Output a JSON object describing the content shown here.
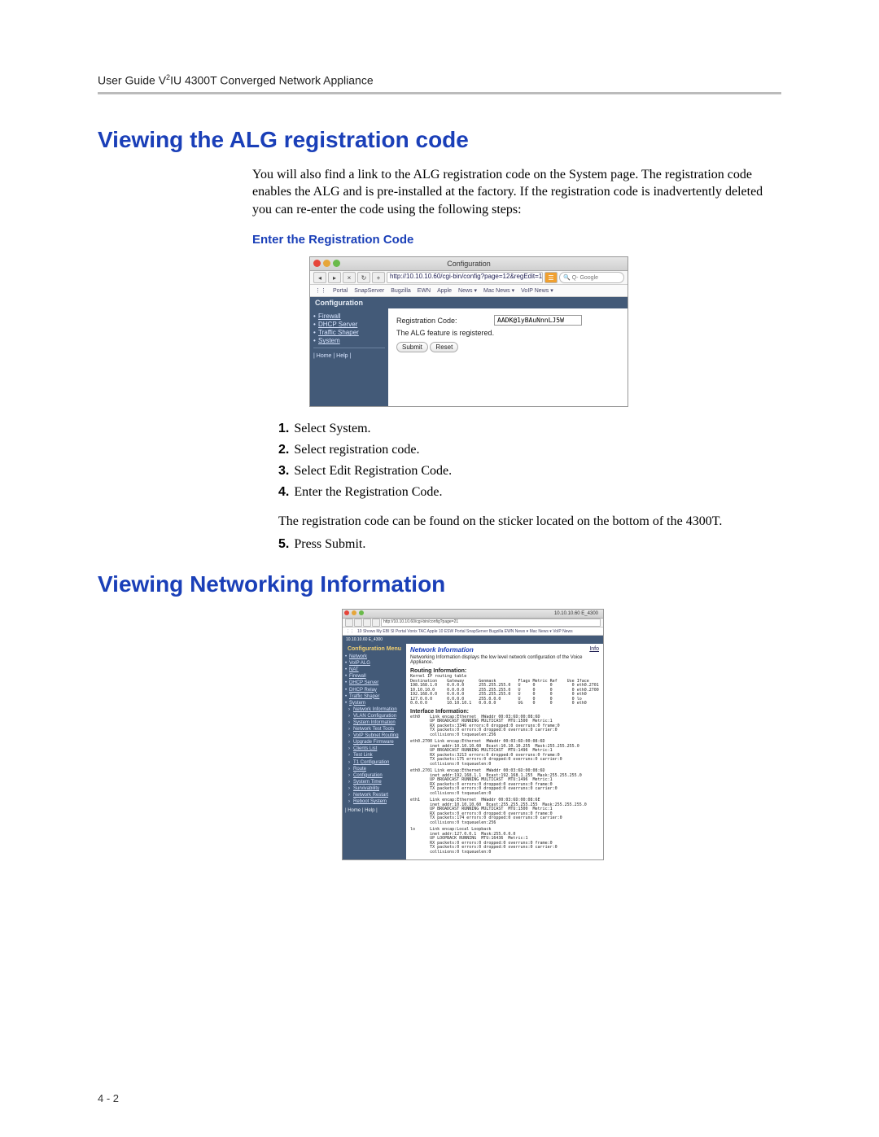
{
  "header": {
    "title": "User Guide V2IU 4300T Converged Network Appliance",
    "sup": "2"
  },
  "section1": {
    "title": "Viewing the ALG registration code",
    "para": "You will also find a link to the ALG registration code on the System page.  The registration code enables the ALG and is pre-installed at the factory.  If the registration code is inadvertently deleted you can re-enter the code using the following steps:",
    "subhead": "Enter the Registration Code"
  },
  "shot1": {
    "windowTitle": "Configuration",
    "url": "http://10.10.10.60/cgi-bin/config?page=12&regEdit=1",
    "searchPlaceholder": "Q- Google",
    "bookmarks": [
      "Portal",
      "SnapServer",
      "Bugzilla",
      "EWN",
      "Apple",
      "News ▾",
      "Mac News ▾",
      "VoIP News ▾"
    ],
    "configLabel": "Configuration",
    "sidebar": [
      "Firewall",
      "DHCP Server",
      "Traffic Shaper",
      "System"
    ],
    "homeHelp": "| Home | Help |",
    "regLabel": "Registration Code:",
    "regValue": "AADK@1yBAuNnnLJ5W",
    "regStatus": "The ALG feature is registered.",
    "submit": "Submit",
    "reset": "Reset"
  },
  "steps": {
    "s1": "Select System.",
    "s2": "Select registration code.",
    "s3": "Select Edit Registration Code.",
    "s4": "Enter the Registration Code.",
    "note": "The registration code can be found on the sticker located on the bottom of the 4300T.",
    "s5": "Press Submit."
  },
  "section2": {
    "title": "Viewing Networking Information"
  },
  "shot2": {
    "hostTitle": "10.10.10.60 E_4300",
    "url": "http://10.10.10.60/cgi-bin/config?page=21",
    "bookmarks": "10 Shows  My EBI  SI Portal  Vonix TAC  Apple  10 ESW  Portal  SnapServer  Bugzilla  EWN  News ▾  Mac News ▾  VoIP News",
    "hostrow": "10.10.10.60 E_4300",
    "menuTitle": "Configuration Menu",
    "sidebarTop": [
      "Network",
      "VoIP ALG",
      "NAT",
      "Firewall",
      "DHCP Server",
      "DHCP Relay",
      "Traffic Shaper",
      "System"
    ],
    "sidebarSub": [
      "Network Information",
      "VLAN Configuration",
      "System Information",
      "Network Test Tools",
      "VoIP Subnet Routing",
      "Upgrade Firmware",
      "Clients List",
      "Test Link",
      "T1 Configuration",
      "Route",
      "Configuration",
      "System Time",
      "Survivability",
      "Network Restart",
      "Reboot System"
    ],
    "homeHelp": "| Home | Help |",
    "infoLink": "Info",
    "pageTitle": "Network Information",
    "desc": "Networking Information displays the low level network configuration of the Voice Appliance.",
    "routingHead": "Routing Information:",
    "routingBlock": "Kernel IP routing table\nDestination    Gateway      Genmask         Flags Metric Ref    Use Iface\n198.168.1.0    0.0.0.0      255.255.255.0   U     0      0        0 eth0.2701\n10.10.10.0     0.0.0.0      255.255.255.0   U     0      0        0 eth0.2700\n192.168.0.0    0.0.0.0      255.255.255.0   U     0      0        0 eth0\n127.0.0.0      0.0.0.0      255.0.0.0       U     0      0        0 lo\n0.0.0.0        10.10.10.1   0.0.0.0         UG    0      0        0 eth0",
    "ifaceHead": "Interface Information:",
    "iface_eth0": "eth0    Link encap:Ethernet  HWaddr 00:03:6D:00:08:6D\n        UP BROADCAST RUNNING MULTICAST  MTU:1500  Metric:1\n        RX packets:3346 errors:0 dropped:0 overruns:0 frame:0\n        TX packets:0 errors:0 dropped:0 overruns:0 carrier:0\n        collisions:0 txqueuelen:256",
    "iface_2700": "eth0.2700 Link encap:Ethernet  HWaddr 00:03:6D:00:08:6D\n        inet addr:10.10.10.60  Bcast:10.10.10.255  Mask:255.255.255.0\n        UP BROADCAST RUNNING MULTICAST  MTU:1496  Metric:1\n        RX packets:3213 errors:0 dropped:0 overruns:0 frame:0\n        TX packets:175 errors:0 dropped:0 overruns:0 carrier:0\n        collisions:0 txqueuelen:0",
    "iface_2701": "eth0.2701 Link encap:Ethernet  HWaddr 00:03:6D:00:08:6D\n        inet addr:192.168.1.1  Bcast:192.168.1.255  Mask:255.255.255.0\n        UP BROADCAST RUNNING MULTICAST  MTU:1496  Metric:1\n        RX packets:0 errors:0 dropped:0 overruns:0 frame:0\n        TX packets:0 errors:0 dropped:0 overruns:0 carrier:0\n        collisions:0 txqueuelen:0",
    "iface_eth1": "eth1    Link encap:Ethernet  HWaddr 00:03:6D:00:08:6E\n        inet addr:10.10.10.60  Bcast:255.255.255.255  Mask:255.255.255.0\n        UP BROADCAST RUNNING MULTICAST  MTU:1500  Metric:1\n        RX packets:0 errors:0 dropped:0 overruns:0 frame:0\n        TX packets:174 errors:0 dropped:0 overruns:0 carrier:0\n        collisions:0 txqueuelen:256",
    "iface_lo": "lo      Link encap:Local Loopback\n        inet addr:127.0.0.1  Mask:255.0.0.0\n        UP LOOPBACK RUNNING  MTU:16436  Metric:1\n        RX packets:0 errors:0 dropped:0 overruns:0 frame:0\n        TX packets:0 errors:0 dropped:0 overruns:0 carrier:0\n        collisions:0 txqueuelen:0"
  },
  "pageNum": "4 - 2"
}
